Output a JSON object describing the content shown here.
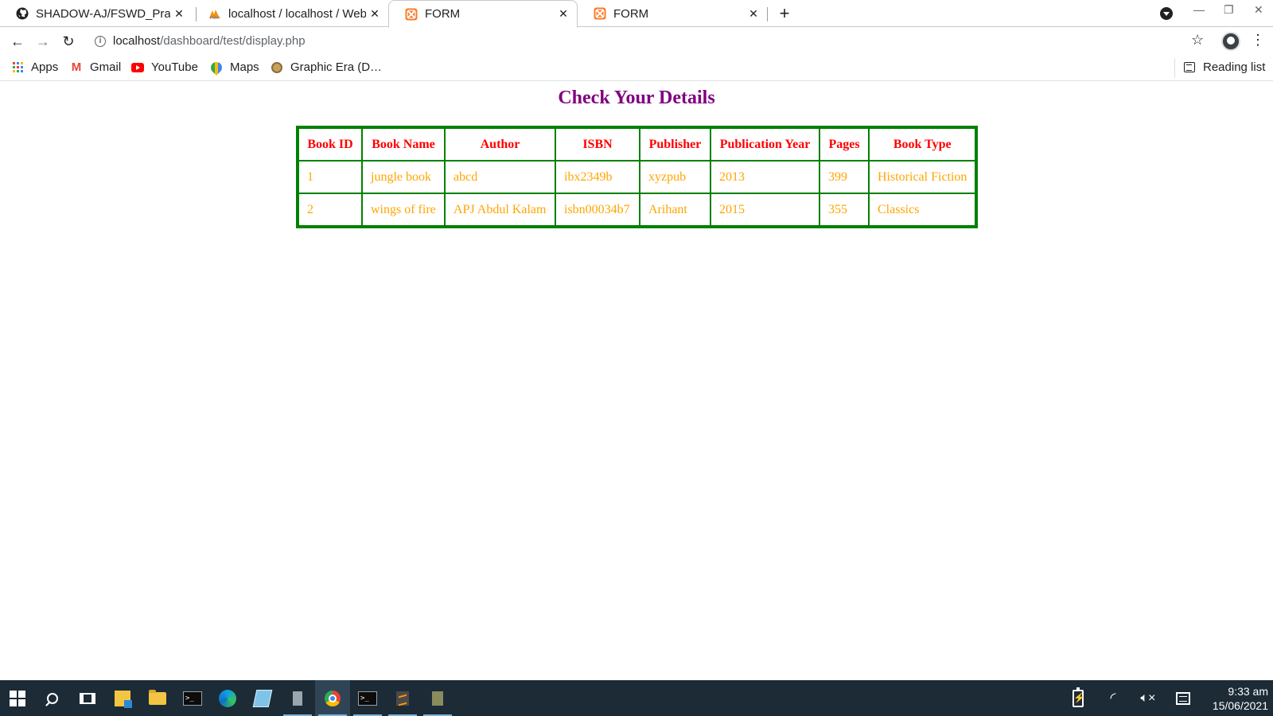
{
  "browser": {
    "tabs": [
      {
        "title": "SHADOW-AJ/FSWD_Prac",
        "favicon": "github-icon",
        "active": false
      },
      {
        "title": "localhost / localhost / WebP",
        "favicon": "phpmyadmin-icon",
        "active": false
      },
      {
        "title": "FORM",
        "favicon": "xampp-icon",
        "active": true
      },
      {
        "title": "FORM",
        "favicon": "xampp-icon",
        "active": false
      }
    ],
    "address_bar": {
      "host": "localhost",
      "path": "/dashboard/test/display.php"
    },
    "bookmarks": [
      {
        "label": "Apps",
        "icon": "apps-grid-icon"
      },
      {
        "label": "Gmail",
        "icon": "gmail-icon"
      },
      {
        "label": "YouTube",
        "icon": "youtube-icon"
      },
      {
        "label": "Maps",
        "icon": "maps-icon"
      },
      {
        "label": "Graphic Era (D…",
        "icon": "graphic-era-icon"
      }
    ],
    "reading_list_label": "Reading list"
  },
  "page": {
    "heading": "Check Your Details",
    "table": {
      "headers": [
        "Book ID",
        "Book Name",
        "Author",
        "ISBN",
        "Publisher",
        "Publication Year",
        "Pages",
        "Book Type"
      ],
      "rows": [
        [
          "1",
          "jungle book",
          "abcd",
          "ibx2349b",
          "xyzpub",
          "2013",
          "399",
          "Historical Fiction"
        ],
        [
          "2",
          "wings of fire",
          "APJ Abdul Kalam",
          "isbn00034b7",
          "Arihant",
          "2015",
          "355",
          "Classics"
        ]
      ]
    }
  },
  "taskbar": {
    "clock_time": "9:33 am",
    "clock_date": "15/06/2021"
  },
  "colors": {
    "heading": "#800080",
    "table_border": "#008000",
    "header_text": "#ff0000",
    "cell_text": "#ffa500",
    "taskbar_bg": "#1c2b36"
  }
}
